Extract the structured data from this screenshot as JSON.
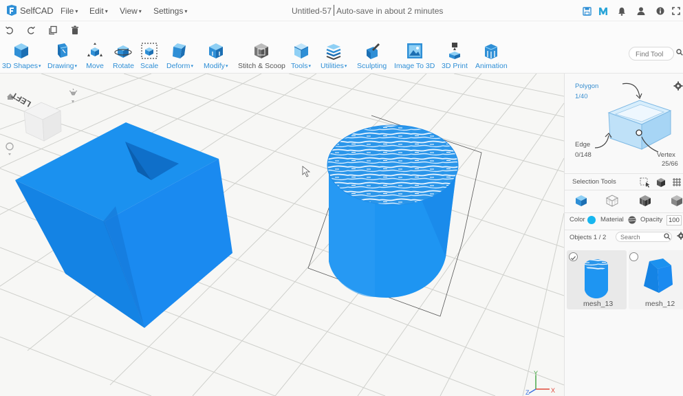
{
  "app": {
    "name": "SelfCAD"
  },
  "menus": [
    "File",
    "Edit",
    "View",
    "Settings"
  ],
  "document": {
    "title": "Untitled-57",
    "autosave": "Auto-save in about 2 minutes"
  },
  "colors": {
    "accent": "#2f8fd6",
    "object": "#1e8fe8",
    "grid": "#cfd0cc"
  },
  "toolbar": {
    "tools": [
      {
        "label": "3D Shapes",
        "icon": "cube-icon"
      },
      {
        "label": "Drawing",
        "icon": "drawing-icon"
      },
      {
        "label": "Move",
        "icon": "move-icon"
      },
      {
        "label": "Rotate",
        "icon": "rotate-icon"
      },
      {
        "label": "Scale",
        "icon": "scale-icon"
      },
      {
        "label": "Deform",
        "icon": "deform-icon"
      },
      {
        "label": "Modify",
        "icon": "modify-icon"
      },
      {
        "label": "Stitch & Scoop",
        "icon": "stitch-scoop-icon"
      },
      {
        "label": "Tools",
        "icon": "tools-icon"
      },
      {
        "label": "Utilities",
        "icon": "utilities-icon"
      },
      {
        "label": "Sculpting",
        "icon": "sculpting-icon"
      },
      {
        "label": "Image To 3D",
        "icon": "image-to-3d-icon"
      },
      {
        "label": "3D Print",
        "icon": "3d-print-icon"
      },
      {
        "label": "Animation",
        "icon": "animation-icon"
      }
    ],
    "find_tool_placeholder": "Find Tool"
  },
  "navcube": {
    "face_label": "LEFT"
  },
  "selection": {
    "polygon_label": "Polygon",
    "polygon_count": "1/40",
    "edge_label": "Edge",
    "edge_count": "0/148",
    "vertex_label": "Vertex",
    "vertex_count": "25/66",
    "tools_label": "Selection Tools"
  },
  "properties": {
    "color_label": "Color",
    "material_label": "Material",
    "opacity_label": "Opacity",
    "opacity_value": "100"
  },
  "objects": {
    "header": "Objects 1 / 2",
    "search_placeholder": "Search",
    "items": [
      {
        "name": "mesh_13",
        "selected": true
      },
      {
        "name": "mesh_12",
        "selected": false
      }
    ]
  },
  "axes": {
    "y": "Y",
    "z": "Z",
    "x": "X"
  }
}
